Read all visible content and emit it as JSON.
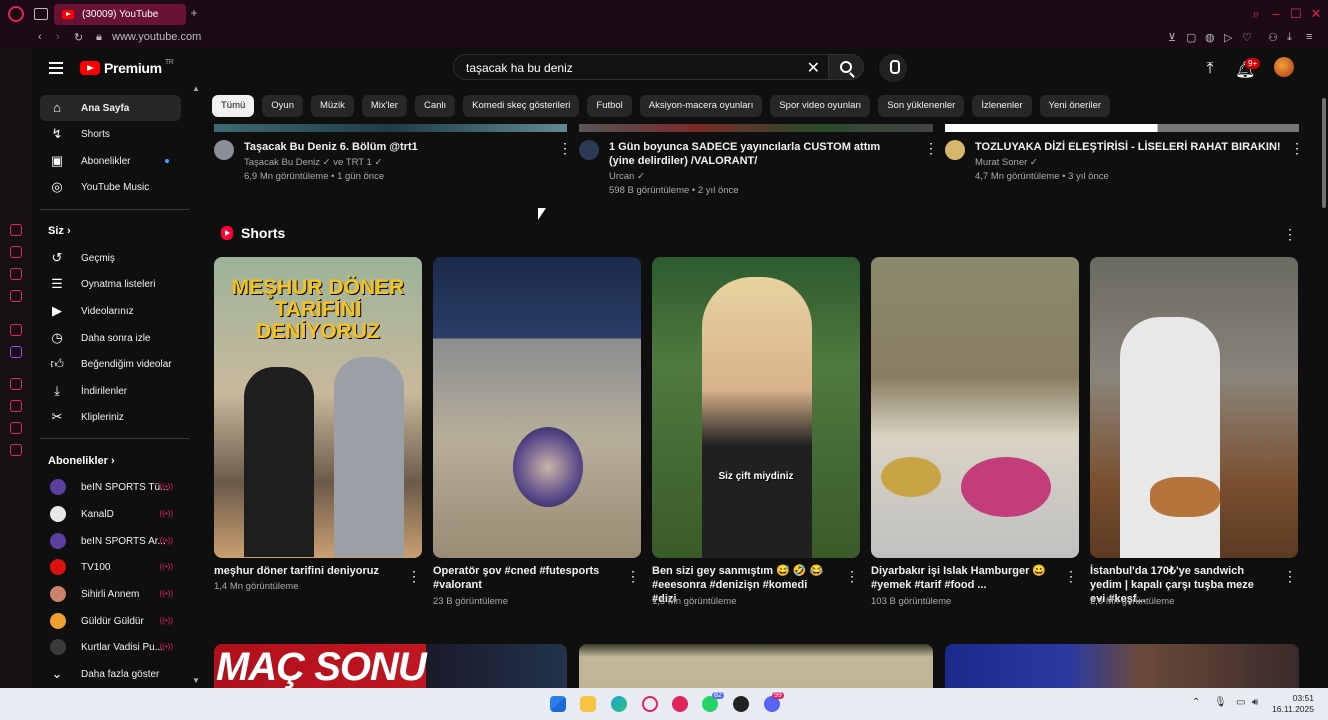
{
  "browser": {
    "tab_title": "(30009) YouTube",
    "new_tab": "+",
    "url": "www.youtube.com"
  },
  "header": {
    "logo_text": "Premium",
    "logo_region": "TR",
    "search_value": "taşacak ha bu deniz",
    "notifications_badge": "9+"
  },
  "sidebar": {
    "main": [
      {
        "label": "Ana Sayfa",
        "icon": "home-icon"
      },
      {
        "label": "Shorts",
        "icon": "shorts-icon"
      },
      {
        "label": "Abonelikler",
        "icon": "subscriptions-icon"
      },
      {
        "label": "YouTube Music",
        "icon": "music-icon"
      }
    ],
    "you_heading": "Siz",
    "you": [
      {
        "label": "Geçmiş",
        "icon": "history-icon"
      },
      {
        "label": "Oynatma listeleri",
        "icon": "playlist-icon"
      },
      {
        "label": "Videolarınız",
        "icon": "your-videos-icon"
      },
      {
        "label": "Daha sonra izle",
        "icon": "watch-later-icon"
      },
      {
        "label": "Beğendiğim videolar",
        "icon": "like-icon"
      },
      {
        "label": "İndirilenler",
        "icon": "download-icon"
      },
      {
        "label": "Klipleriniz",
        "icon": "scissors-icon"
      }
    ],
    "subs_heading": "Abonelikler",
    "subs": [
      {
        "label": "beIN SPORTS Tü...",
        "color": "#5b3fa0"
      },
      {
        "label": "KanalD",
        "color": "#e8e8e8"
      },
      {
        "label": "beIN SPORTS Ar...",
        "color": "#5b3fa0"
      },
      {
        "label": "TV100",
        "color": "#d11"
      },
      {
        "label": "Sihirli Annem",
        "color": "#c9826b"
      },
      {
        "label": "Güldür Güldür",
        "color": "#f0a030"
      },
      {
        "label": "Kurtlar Vadisi Pu...",
        "color": "#3a3a3a"
      }
    ],
    "show_more": "Daha fazla göster"
  },
  "chips": [
    "Tümü",
    "Oyun",
    "Müzik",
    "Mix'ler",
    "Canlı",
    "Komedi skeç gösterileri",
    "Futbol",
    "Aksiyon-macera oyunları",
    "Spor video oyunları",
    "Son yüklenenler",
    "İzlenenler",
    "Yeni öneriler"
  ],
  "videos": [
    {
      "title": "Taşacak Bu Deniz 6. Bölüm @trt1",
      "channel": "Taşacak Bu Deniz",
      "channel_extra": "ve TRT 1",
      "stats": "6,9 Mn görüntüleme • 1 gün önce",
      "avatar_color": "#8a8f9a"
    },
    {
      "title": "1 Gün boyunca SADECE yayıncılarla CUSTOM attım (yine delirdiler) /VALORANT/",
      "channel": "Urcan",
      "channel_extra": "",
      "stats": "598 B görüntüleme • 2 yıl önce",
      "avatar_color": "#2c3a55"
    },
    {
      "title": "TOZLUYAKA DİZİ ELEŞTİRİSİ - LİSELERİ RAHAT BIRAKIN!",
      "channel": "Murat Soner",
      "channel_extra": "",
      "stats": "4,7 Mn görüntüleme • 3 yıl önce",
      "avatar_color": "#d8b66a"
    }
  ],
  "shorts_heading": "Shorts",
  "shorts": [
    {
      "title": "meşhur döner tarifini deniyoruz",
      "views": "1,4 Mn görüntüleme",
      "overlay": "MEŞHUR DÖNER TARİFİNİ DENİYORUZ"
    },
    {
      "title": "Operatör şov #cned #futesports #valorant",
      "views": "23 B görüntüleme",
      "overlay": ""
    },
    {
      "title": "Ben sizi gey sanmıştım 😅 🤣 😂 #eeesonra #denizişn #komedi #dizi",
      "views": "1,5 Mn görüntüleme",
      "overlay": "Siz çift miydiniz"
    },
    {
      "title": "Diyarbakır işi Islak Hamburger 😀 #yemek #tarif #food ...",
      "views": "103 B görüntüleme",
      "overlay": ""
    },
    {
      "title": "İstanbul'da 170₺'ye sandwich yedim | kapalı çarşı tuşba meze evi #keşf...",
      "views": "2,8 Mn görüntüleme",
      "overlay": ""
    }
  ],
  "bottom_thumb_text": "MAÇ SONU",
  "taskbar": {
    "time": "03:51",
    "date": "16.11.2025",
    "whatsapp_badge": "82",
    "discord_badge": "99"
  }
}
